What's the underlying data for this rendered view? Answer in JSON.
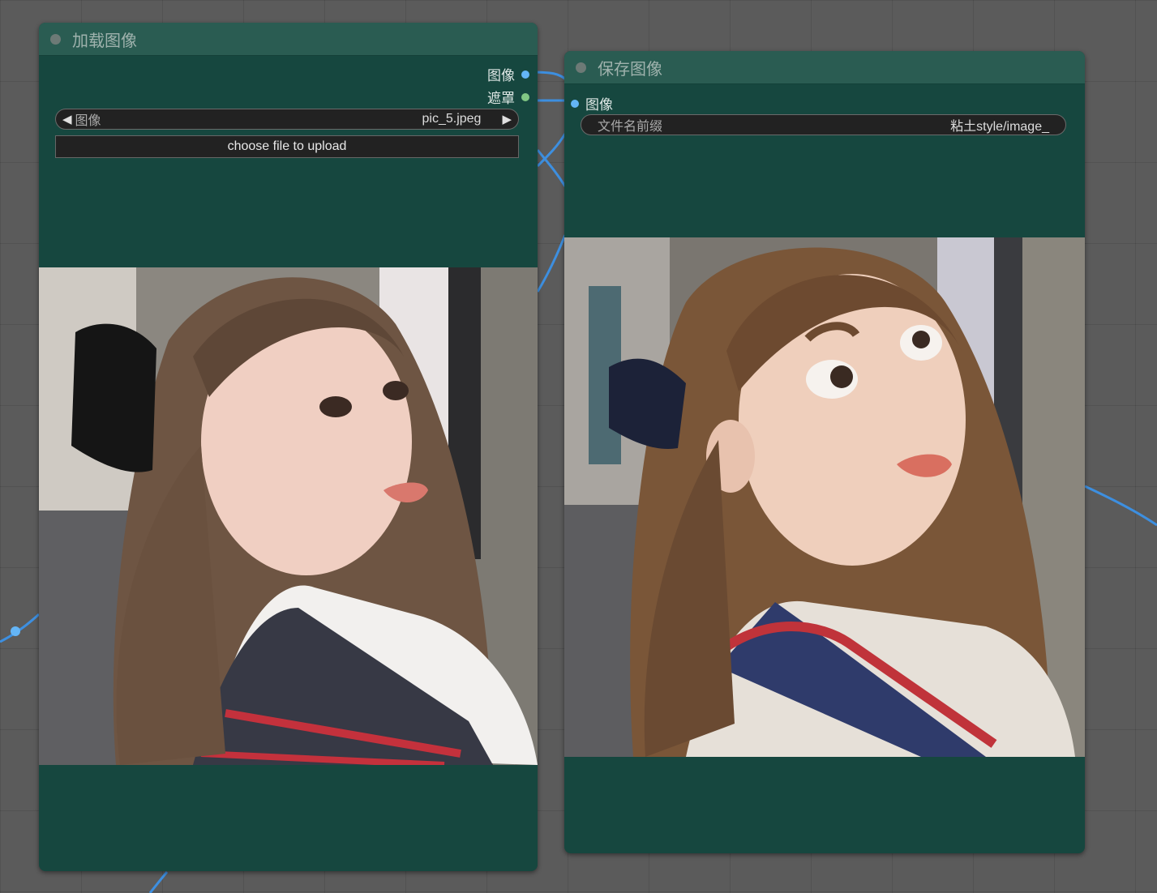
{
  "colors": {
    "canvas": "#5b5b5b",
    "node_body": "#16473f",
    "node_header": "#2a5c52",
    "image_socket": "#64b5f6",
    "mask_socket": "#81c784",
    "link": "#3d8fe0",
    "widget_bg": "#222222"
  },
  "load_node": {
    "title": "加载图像",
    "outputs": [
      {
        "label": "图像",
        "icon": "image-output-socket-icon"
      },
      {
        "label": "遮罩",
        "icon": "mask-output-socket-icon"
      }
    ],
    "image_widget": {
      "label": "图像",
      "value": "pic_5.jpeg",
      "prev_icon": "◀",
      "next_icon": "▶"
    },
    "upload_button": "choose file to upload",
    "preview": "photo of a young woman with long brown hair, black hair bow and sailor school uniform"
  },
  "save_node": {
    "title": "保存图像",
    "inputs": [
      {
        "label": "图像",
        "icon": "image-input-socket-icon"
      }
    ],
    "filename_prefix": {
      "label": "文件名前缀",
      "value": "粘土style/image_"
    },
    "preview": "clay-style stylized version of the same girl with big eyes in sailor uniform"
  }
}
